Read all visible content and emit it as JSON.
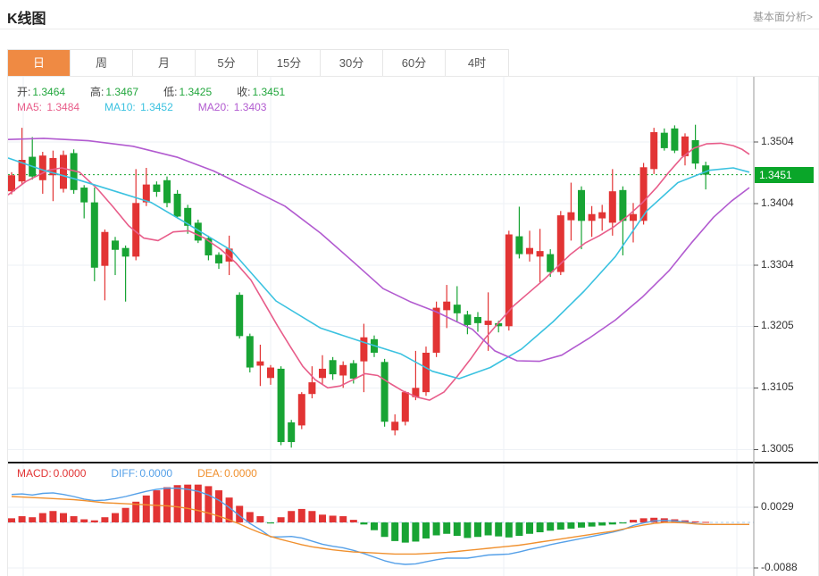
{
  "header": {
    "title": "K线图",
    "link": "基本面分析>"
  },
  "tabs": {
    "items": [
      "日",
      "周",
      "月",
      "5分",
      "15分",
      "30分",
      "60分",
      "4时"
    ],
    "selected_index": 0,
    "selected_color": "#ef8a43"
  },
  "legend": {
    "ohlc": [
      {
        "label": "开:",
        "value": "1.3464"
      },
      {
        "label": "高:",
        "value": "1.3467"
      },
      {
        "label": "低:",
        "value": "1.3425"
      },
      {
        "label": "收:",
        "value": "1.3451"
      }
    ],
    "ohlc_value_color": "#21a63c",
    "ma": [
      {
        "label": "MA5:",
        "value": "1.3484",
        "color": "#e85d8a"
      },
      {
        "label": "MA10:",
        "value": "1.3452",
        "color": "#3bc2e0"
      },
      {
        "label": "MA20:",
        "value": "1.3403",
        "color": "#b25bd0"
      }
    ]
  },
  "macd_legend": [
    {
      "label": "MACD:",
      "value": "0.0000",
      "color": "#e23434"
    },
    {
      "label": "DIFF:",
      "value": "0.0000",
      "color": "#55a0e8"
    },
    {
      "label": "DEA:",
      "value": "0.0000",
      "color": "#f0902e"
    }
  ],
  "price_axis": {
    "ticks": [
      "1.3504",
      "1.3404",
      "1.3304",
      "1.3205",
      "1.3105",
      "1.3005"
    ],
    "tick_values": [
      1.3504,
      1.3404,
      1.3304,
      1.3205,
      1.3105,
      1.3005
    ],
    "current": {
      "label": "1.3451",
      "value": 1.3451,
      "badge_color": "#0aa629"
    }
  },
  "macd_axis": {
    "ticks": [
      "0.0029",
      "-0.0088"
    ],
    "tick_values": [
      0.0029,
      -0.0088
    ]
  },
  "chart_data": {
    "type": "candlestick+macd",
    "title": "K线图",
    "period": "日",
    "up_color": "#e23434",
    "down_color": "#18a434",
    "grid_color": "#eef1f6",
    "current_price": 1.3451,
    "y_axis_range": [
      1.2985,
      1.353
    ],
    "macd_axis_range": [
      -0.0098,
      0.0052
    ],
    "candles_ohlc": [
      [
        1.3424,
        1.3455,
        1.3419,
        1.345
      ],
      [
        1.344,
        1.3527,
        1.3435,
        1.3475
      ],
      [
        1.348,
        1.3512,
        1.3443,
        1.3448
      ],
      [
        1.3442,
        1.3488,
        1.342,
        1.3482
      ],
      [
        1.345,
        1.349,
        1.3408,
        1.3478
      ],
      [
        1.3428,
        1.349,
        1.3422,
        1.3483
      ],
      [
        1.3486,
        1.3492,
        1.342,
        1.3426
      ],
      [
        1.343,
        1.3434,
        1.338,
        1.3406
      ],
      [
        1.3406,
        1.343,
        1.3278,
        1.33
      ],
      [
        1.3303,
        1.3362,
        1.3247,
        1.3358
      ],
      [
        1.3344,
        1.335,
        1.3288,
        1.3329
      ],
      [
        1.3332,
        1.3336,
        1.3245,
        1.3318
      ],
      [
        1.3318,
        1.346,
        1.3312,
        1.3405
      ],
      [
        1.3406,
        1.3462,
        1.34,
        1.3435
      ],
      [
        1.3435,
        1.344,
        1.3415,
        1.3423
      ],
      [
        1.3442,
        1.3448,
        1.3398,
        1.3405
      ],
      [
        1.342,
        1.3426,
        1.338,
        1.3383
      ],
      [
        1.3397,
        1.3402,
        1.3355,
        1.3368
      ],
      [
        1.3373,
        1.3378,
        1.334,
        1.3344
      ],
      [
        1.3348,
        1.3352,
        1.3312,
        1.332
      ],
      [
        1.3321,
        1.3325,
        1.3298,
        1.3307
      ],
      [
        1.331,
        1.3352,
        1.3288,
        1.3331
      ],
      [
        1.3256,
        1.326,
        1.3185,
        1.3189
      ],
      [
        1.3189,
        1.3193,
        1.313,
        1.3138
      ],
      [
        1.3141,
        1.3175,
        1.3108,
        1.3148
      ],
      [
        1.3121,
        1.3142,
        1.311,
        1.3138
      ],
      [
        1.3136,
        1.314,
        1.3012,
        1.3017
      ],
      [
        1.3049,
        1.3053,
        1.3008,
        1.3017
      ],
      [
        1.3044,
        1.3098,
        1.3038,
        1.3095
      ],
      [
        1.3095,
        1.314,
        1.3088,
        1.3114
      ],
      [
        1.3121,
        1.3158,
        1.311,
        1.3136
      ],
      [
        1.315,
        1.3155,
        1.3118,
        1.3127
      ],
      [
        1.3125,
        1.3148,
        1.3105,
        1.3142
      ],
      [
        1.3145,
        1.315,
        1.3112,
        1.312
      ],
      [
        1.3148,
        1.3209,
        1.3098,
        1.3187
      ],
      [
        1.3184,
        1.319,
        1.3155,
        1.3162
      ],
      [
        1.3147,
        1.3152,
        1.3042,
        1.305
      ],
      [
        1.3036,
        1.3062,
        1.3028,
        1.305
      ],
      [
        1.305,
        1.31,
        1.3044,
        1.3098
      ],
      [
        1.309,
        1.3165,
        1.3085,
        1.3105
      ],
      [
        1.3098,
        1.3172,
        1.3092,
        1.3162
      ],
      [
        1.3162,
        1.3245,
        1.3155,
        1.3235
      ],
      [
        1.3231,
        1.3272,
        1.3202,
        1.3245
      ],
      [
        1.324,
        1.327,
        1.3212,
        1.3226
      ],
      [
        1.3224,
        1.323,
        1.3192,
        1.3207
      ],
      [
        1.322,
        1.3228,
        1.3196,
        1.321
      ],
      [
        1.3207,
        1.326,
        1.3165,
        1.3214
      ],
      [
        1.321,
        1.3214,
        1.3195,
        1.3205
      ],
      [
        1.3205,
        1.336,
        1.3198,
        1.3354
      ],
      [
        1.3351,
        1.3399,
        1.3315,
        1.3322
      ],
      [
        1.3322,
        1.336,
        1.331,
        1.3332
      ],
      [
        1.3318,
        1.3363,
        1.3276,
        1.3327
      ],
      [
        1.3322,
        1.333,
        1.3285,
        1.3293
      ],
      [
        1.3293,
        1.3392,
        1.3288,
        1.3385
      ],
      [
        1.3377,
        1.3438,
        1.3344,
        1.339
      ],
      [
        1.3426,
        1.3432,
        1.333,
        1.3376
      ],
      [
        1.3376,
        1.34,
        1.335,
        1.3387
      ],
      [
        1.338,
        1.3402,
        1.336,
        1.339
      ],
      [
        1.3373,
        1.346,
        1.3352,
        1.3424
      ],
      [
        1.3426,
        1.3432,
        1.332,
        1.3376
      ],
      [
        1.3376,
        1.3405,
        1.3341,
        1.3387
      ],
      [
        1.3376,
        1.347,
        1.337,
        1.3463
      ],
      [
        1.346,
        1.3527,
        1.3452,
        1.352
      ],
      [
        1.3519,
        1.3526,
        1.349,
        1.3494
      ],
      [
        1.3526,
        1.3531,
        1.3486,
        1.349
      ],
      [
        1.3481,
        1.3518,
        1.3466,
        1.3513
      ],
      [
        1.3507,
        1.3532,
        1.346,
        1.3469
      ],
      [
        1.3466,
        1.3472,
        1.3427,
        1.3451
      ]
    ],
    "ma_lines": [
      {
        "name": "MA5",
        "color": "#e85d8a",
        "points": [
          [
            0,
            1.3418
          ],
          [
            20,
            1.344
          ],
          [
            45,
            1.3458
          ],
          [
            60,
            1.3462
          ],
          [
            80,
            1.3455
          ],
          [
            100,
            1.3428
          ],
          [
            118,
            1.3398
          ],
          [
            135,
            1.3368
          ],
          [
            152,
            1.3348
          ],
          [
            168,
            1.3344
          ],
          [
            185,
            1.3358
          ],
          [
            202,
            1.336
          ],
          [
            220,
            1.3348
          ],
          [
            238,
            1.333
          ],
          [
            255,
            1.3308
          ],
          [
            272,
            1.328
          ],
          [
            288,
            1.324
          ],
          [
            302,
            1.3205
          ],
          [
            316,
            1.3172
          ],
          [
            330,
            1.314
          ],
          [
            344,
            1.3118
          ],
          [
            358,
            1.3105
          ],
          [
            372,
            1.3108
          ],
          [
            386,
            1.3118
          ],
          [
            400,
            1.3128
          ],
          [
            414,
            1.3125
          ],
          [
            428,
            1.3112
          ],
          [
            442,
            1.31
          ],
          [
            458,
            1.309
          ],
          [
            472,
            1.3085
          ],
          [
            488,
            1.3098
          ],
          [
            502,
            1.3122
          ],
          [
            518,
            1.3152
          ],
          [
            534,
            1.3185
          ],
          [
            550,
            1.3212
          ],
          [
            566,
            1.3238
          ],
          [
            582,
            1.3258
          ],
          [
            598,
            1.3278
          ],
          [
            614,
            1.33
          ],
          [
            630,
            1.3322
          ],
          [
            646,
            1.334
          ],
          [
            662,
            1.3352
          ],
          [
            678,
            1.3366
          ],
          [
            694,
            1.3384
          ],
          [
            710,
            1.3405
          ],
          [
            726,
            1.343
          ],
          [
            740,
            1.3455
          ],
          [
            754,
            1.3478
          ],
          [
            768,
            1.3494
          ],
          [
            782,
            1.3501
          ],
          [
            798,
            1.3502
          ],
          [
            812,
            1.3498
          ],
          [
            822,
            1.3492
          ],
          [
            830,
            1.3484
          ]
        ]
      },
      {
        "name": "MA10",
        "color": "#3bc2e0",
        "points": [
          [
            0,
            1.3478
          ],
          [
            40,
            1.3458
          ],
          [
            80,
            1.3442
          ],
          [
            120,
            1.3424
          ],
          [
            160,
            1.3406
          ],
          [
            200,
            1.3372
          ],
          [
            250,
            1.3328
          ],
          [
            300,
            1.3246
          ],
          [
            350,
            1.3202
          ],
          [
            400,
            1.3178
          ],
          [
            440,
            1.316
          ],
          [
            475,
            1.3132
          ],
          [
            505,
            1.312
          ],
          [
            540,
            1.3138
          ],
          [
            575,
            1.3168
          ],
          [
            610,
            1.3212
          ],
          [
            645,
            1.3262
          ],
          [
            680,
            1.3318
          ],
          [
            715,
            1.3392
          ],
          [
            750,
            1.3438
          ],
          [
            785,
            1.3458
          ],
          [
            812,
            1.3462
          ],
          [
            830,
            1.3455
          ]
        ]
      },
      {
        "name": "MA20",
        "color": "#b25bd0",
        "points": [
          [
            0,
            1.3508
          ],
          [
            40,
            1.351
          ],
          [
            90,
            1.3506
          ],
          [
            140,
            1.3497
          ],
          [
            190,
            1.3479
          ],
          [
            230,
            1.3457
          ],
          [
            270,
            1.3429
          ],
          [
            310,
            1.34
          ],
          [
            350,
            1.3356
          ],
          [
            390,
            1.3305
          ],
          [
            420,
            1.3266
          ],
          [
            450,
            1.3245
          ],
          [
            480,
            1.3228
          ],
          [
            520,
            1.32
          ],
          [
            545,
            1.3165
          ],
          [
            570,
            1.3149
          ],
          [
            595,
            1.3148
          ],
          [
            620,
            1.3158
          ],
          [
            650,
            1.3185
          ],
          [
            680,
            1.3215
          ],
          [
            710,
            1.3252
          ],
          [
            740,
            1.3295
          ],
          [
            765,
            1.334
          ],
          [
            790,
            1.3382
          ],
          [
            810,
            1.3408
          ],
          [
            830,
            1.343
          ]
        ]
      }
    ],
    "macd": {
      "histogram": [
        0.0008,
        0.0012,
        0.001,
        0.0018,
        0.0022,
        0.0018,
        0.0012,
        0.0006,
        0.0004,
        0.001,
        0.0018,
        0.0028,
        0.004,
        0.0052,
        0.0062,
        0.0068,
        0.0072,
        0.0073,
        0.0073,
        0.007,
        0.0062,
        0.0048,
        0.0032,
        0.002,
        0.0012,
        -0.0002,
        0.001,
        0.0022,
        0.0026,
        0.0022,
        0.0015,
        0.0013,
        0.0012,
        0.0005,
        -0.0004,
        -0.0015,
        -0.0028,
        -0.0036,
        -0.0039,
        -0.0037,
        -0.0031,
        -0.0025,
        -0.0022,
        -0.0026,
        -0.003,
        -0.0028,
        -0.0025,
        -0.0027,
        -0.0029,
        -0.0026,
        -0.0022,
        -0.0019,
        -0.0016,
        -0.0014,
        -0.0012,
        -0.001,
        -0.0008,
        -0.0006,
        -0.0004,
        -0.0002,
        0.0005,
        0.0008,
        0.0009,
        0.0008,
        0.0006,
        0.0004,
        0.0002,
        0.0001
      ],
      "diff": [
        0.0054,
        0.0055,
        0.0053,
        0.0056,
        0.0057,
        0.0054,
        0.005,
        0.0045,
        0.0042,
        0.0043,
        0.0046,
        0.005,
        0.0055,
        0.006,
        0.0064,
        0.0066,
        0.0066,
        0.0064,
        0.006,
        0.0053,
        0.0043,
        0.0029,
        0.0013,
        -0.0002,
        -0.0014,
        -0.0028,
        -0.0028,
        -0.0027,
        -0.003,
        -0.0036,
        -0.0042,
        -0.0046,
        -0.0049,
        -0.0054,
        -0.006,
        -0.0067,
        -0.0074,
        -0.0079,
        -0.0081,
        -0.008,
        -0.0076,
        -0.0072,
        -0.0069,
        -0.0069,
        -0.0069,
        -0.0066,
        -0.0063,
        -0.0062,
        -0.0061,
        -0.0057,
        -0.0052,
        -0.0048,
        -0.0043,
        -0.0039,
        -0.0035,
        -0.0031,
        -0.0027,
        -0.0023,
        -0.0019,
        -0.0014,
        -0.0006,
        -0.0001,
        0.0003,
        0.0004,
        0.0003,
        0.0001,
        -0.0002,
        -0.0004
      ],
      "dea": [
        0.005,
        0.0049,
        0.0048,
        0.0047,
        0.0046,
        0.0045,
        0.0044,
        0.0042,
        0.004,
        0.0038,
        0.0037,
        0.0036,
        0.0035,
        0.0034,
        0.0033,
        0.0032,
        0.003,
        0.0027,
        0.0023,
        0.0018,
        0.0012,
        0.0005,
        -0.0003,
        -0.0012,
        -0.002,
        -0.0027,
        -0.0033,
        -0.0038,
        -0.0043,
        -0.0047,
        -0.005,
        -0.0053,
        -0.0055,
        -0.0057,
        -0.0058,
        -0.0059,
        -0.006,
        -0.0061,
        -0.0061,
        -0.0061,
        -0.006,
        -0.0059,
        -0.0058,
        -0.0056,
        -0.0054,
        -0.0052,
        -0.005,
        -0.0048,
        -0.0046,
        -0.0044,
        -0.0041,
        -0.0038,
        -0.0035,
        -0.0032,
        -0.0029,
        -0.0026,
        -0.0023,
        -0.002,
        -0.0017,
        -0.0013,
        -0.0009,
        -0.0005,
        -0.0002,
        0.0,
        0.0,
        -0.0001,
        -0.0003,
        -0.0004
      ],
      "diff_color": "#55a0e8",
      "dea_color": "#f0902e",
      "zero_line_color": "#a9cdee"
    }
  }
}
